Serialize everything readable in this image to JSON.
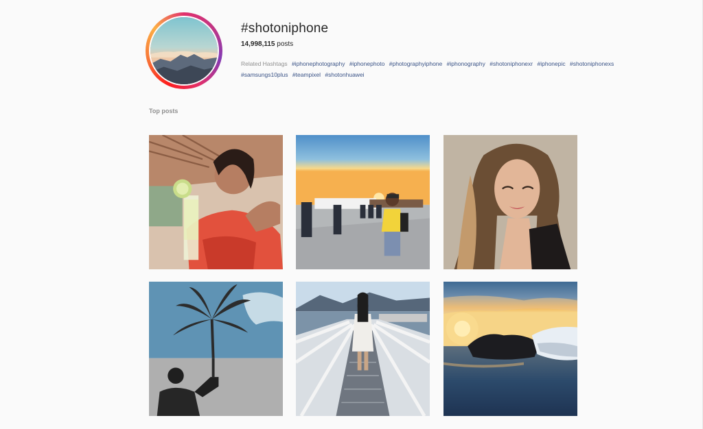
{
  "hashtag": {
    "title": "#shotoniphone",
    "post_count": "14,998,115",
    "post_count_suffix": " posts"
  },
  "related": {
    "label": "Related Hashtags",
    "tags": [
      "#iphonephotography",
      "#iphonephoto",
      "#photographyiphone",
      "#iphonography",
      "#shotoniphonexr",
      "#iphonepic",
      "#shotoniphonexs",
      "#samsungs10plus",
      "#teampixel",
      "#shotonhuawei"
    ]
  },
  "section": {
    "top_posts_label": "Top posts"
  },
  "colors": {
    "link": "#385185",
    "muted": "#8e8e8e",
    "text": "#262626",
    "background": "#fafafa"
  }
}
